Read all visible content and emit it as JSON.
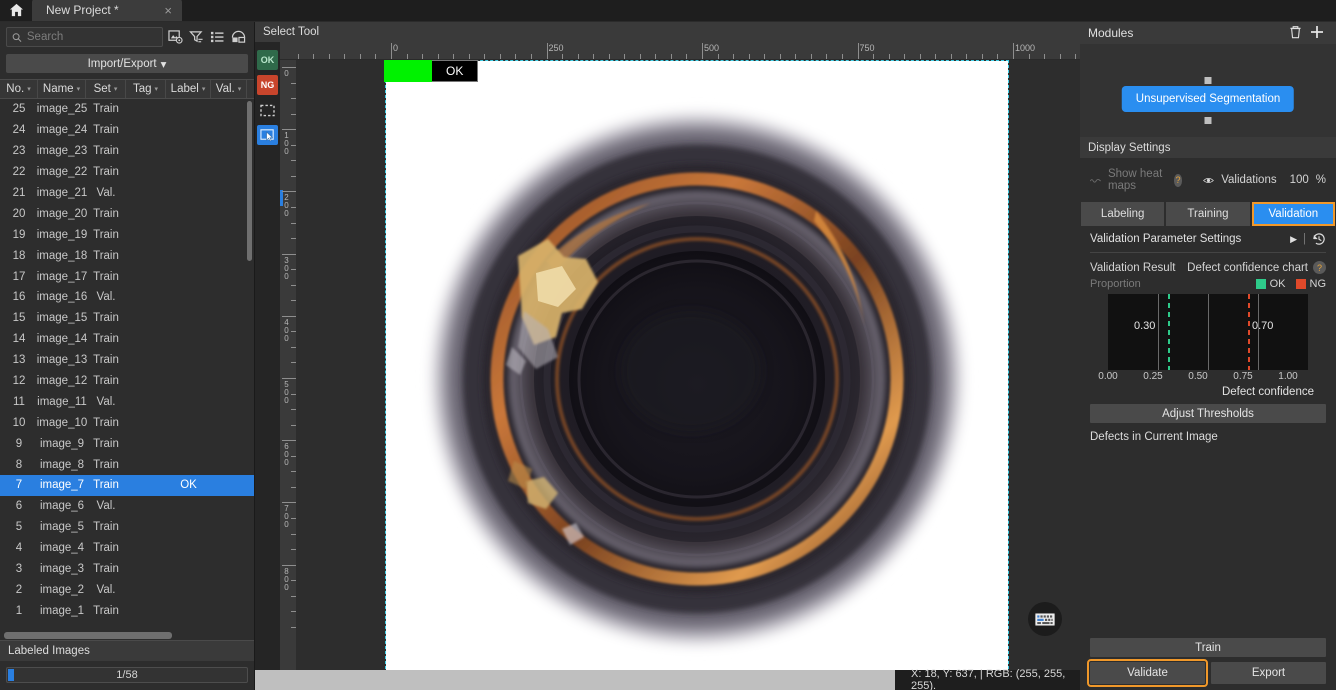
{
  "titlebar": {
    "home_icon": "home-icon",
    "tab_label": "New Project *",
    "tab_close": "×"
  },
  "left_panel": {
    "search": {
      "placeholder": "Search",
      "value": "",
      "icon": "search-icon"
    },
    "tool_icons": [
      "image-settings-icon",
      "filter-icon",
      "list-view-icon",
      "layout-view-icon"
    ],
    "import_export_label": "Import/Export",
    "import_export_caret": "▾",
    "columns": [
      "No.",
      "Name",
      "Set",
      "Tag",
      "Label",
      "Val."
    ],
    "rows": [
      {
        "no": "1",
        "name": "image_1",
        "set": "Train",
        "tag": "",
        "label": "",
        "val": ""
      },
      {
        "no": "2",
        "name": "image_2",
        "set": "Val.",
        "tag": "",
        "label": "",
        "val": ""
      },
      {
        "no": "3",
        "name": "image_3",
        "set": "Train",
        "tag": "",
        "label": "",
        "val": ""
      },
      {
        "no": "4",
        "name": "image_4",
        "set": "Train",
        "tag": "",
        "label": "",
        "val": ""
      },
      {
        "no": "5",
        "name": "image_5",
        "set": "Train",
        "tag": "",
        "label": "",
        "val": ""
      },
      {
        "no": "6",
        "name": "image_6",
        "set": "Val.",
        "tag": "",
        "label": "",
        "val": ""
      },
      {
        "no": "7",
        "name": "image_7",
        "set": "Train",
        "tag": "",
        "label": "OK",
        "val": "",
        "selected": true
      },
      {
        "no": "8",
        "name": "image_8",
        "set": "Train",
        "tag": "",
        "label": "",
        "val": ""
      },
      {
        "no": "9",
        "name": "image_9",
        "set": "Train",
        "tag": "",
        "label": "",
        "val": ""
      },
      {
        "no": "10",
        "name": "image_10",
        "set": "Train",
        "tag": "",
        "label": "",
        "val": ""
      },
      {
        "no": "11",
        "name": "image_11",
        "set": "Val.",
        "tag": "",
        "label": "",
        "val": ""
      },
      {
        "no": "12",
        "name": "image_12",
        "set": "Train",
        "tag": "",
        "label": "",
        "val": ""
      },
      {
        "no": "13",
        "name": "image_13",
        "set": "Train",
        "tag": "",
        "label": "",
        "val": ""
      },
      {
        "no": "14",
        "name": "image_14",
        "set": "Train",
        "tag": "",
        "label": "",
        "val": ""
      },
      {
        "no": "15",
        "name": "image_15",
        "set": "Train",
        "tag": "",
        "label": "",
        "val": ""
      },
      {
        "no": "16",
        "name": "image_16",
        "set": "Val.",
        "tag": "",
        "label": "",
        "val": ""
      },
      {
        "no": "17",
        "name": "image_17",
        "set": "Train",
        "tag": "",
        "label": "",
        "val": ""
      },
      {
        "no": "18",
        "name": "image_18",
        "set": "Train",
        "tag": "",
        "label": "",
        "val": ""
      },
      {
        "no": "19",
        "name": "image_19",
        "set": "Train",
        "tag": "",
        "label": "",
        "val": ""
      },
      {
        "no": "20",
        "name": "image_20",
        "set": "Train",
        "tag": "",
        "label": "",
        "val": ""
      },
      {
        "no": "21",
        "name": "image_21",
        "set": "Val.",
        "tag": "",
        "label": "",
        "val": ""
      },
      {
        "no": "22",
        "name": "image_22",
        "set": "Train",
        "tag": "",
        "label": "",
        "val": ""
      },
      {
        "no": "23",
        "name": "image_23",
        "set": "Train",
        "tag": "",
        "label": "",
        "val": ""
      },
      {
        "no": "24",
        "name": "image_24",
        "set": "Train",
        "tag": "",
        "label": "",
        "val": ""
      },
      {
        "no": "25",
        "name": "image_25",
        "set": "Train",
        "tag": "",
        "label": "",
        "val": ""
      }
    ],
    "labeled_images_header": "Labeled Images",
    "progress_text": "1/58"
  },
  "center": {
    "tool_header": "Select Tool",
    "vtools": [
      {
        "name": "ok-tool",
        "label": "OK"
      },
      {
        "name": "ng-tool",
        "label": "NG"
      },
      {
        "name": "marquee-select-tool",
        "label": ""
      },
      {
        "name": "move-select-tool",
        "label": ""
      }
    ],
    "h_ruler_ticks": [
      "0",
      "250",
      "500",
      "750",
      "1000"
    ],
    "v_ruler_ticks": [
      "0",
      "100",
      "200",
      "300",
      "400",
      "500",
      "600",
      "700",
      "800"
    ],
    "image_badge": {
      "label": "OK",
      "swatch_color": "#00f200"
    },
    "keyboard_icon": "keyboard-icon",
    "status_text": "X: 18, Y: 637, | RGB: (255, 255, 255)."
  },
  "right_panel": {
    "modules_header": "Modules",
    "delete_icon": "trash-icon",
    "add_icon": "plus-icon",
    "module_node": "Unsupervised Segmentation",
    "display_settings_header": "Display Settings",
    "show_heat_maps_label": "Show heat maps",
    "heat_maps_help": "?",
    "eye_icon": "eye-icon",
    "validations_label": "Validations",
    "validations_value": "100",
    "validations_unit": "%",
    "tabs": [
      {
        "label": "Labeling",
        "active": false
      },
      {
        "label": "Training",
        "active": false
      },
      {
        "label": "Validation",
        "active": true
      }
    ],
    "validation_param_settings": "Validation Parameter Settings",
    "expand_icon": "play-triangle-icon",
    "history_icon": "history-revert-icon",
    "validation_result_label": "Validation Result",
    "defect_chart_label": "Defect confidence chart",
    "defect_chart_help": "?",
    "adjust_thresholds_label": "Adjust Thresholds",
    "defects_in_current_image": "Defects in Current Image",
    "train_button": "Train",
    "validate_button": "Validate",
    "export_button": "Export",
    "accent_color": "#2a8ef0",
    "highlight_color": "#f0982a",
    "ok_color": "#2ecb8a",
    "ng_color": "#e0492a"
  },
  "chart_data": {
    "type": "bar",
    "title": "Defect confidence chart",
    "xlabel": "Defect confidence",
    "ylabel": "Proportion",
    "xlim": [
      0,
      1
    ],
    "ticks": [
      "0.00",
      "0.25",
      "0.50",
      "0.75",
      "1.00"
    ],
    "gridlines": [
      0.25,
      0.5,
      0.75
    ],
    "legend": [
      {
        "name": "OK",
        "color": "#2ecb8a"
      },
      {
        "name": "NG",
        "color": "#e0492a"
      }
    ],
    "thresholds": [
      {
        "name": "OK",
        "value": 0.3,
        "label": "0.30",
        "color": "#2ecb8a",
        "style": "dashed"
      },
      {
        "name": "NG",
        "value": 0.7,
        "label": "0.70",
        "color": "#e0492a",
        "style": "dashed"
      }
    ],
    "categories": [],
    "values": [],
    "grid": true,
    "legend_position": "top-right"
  }
}
